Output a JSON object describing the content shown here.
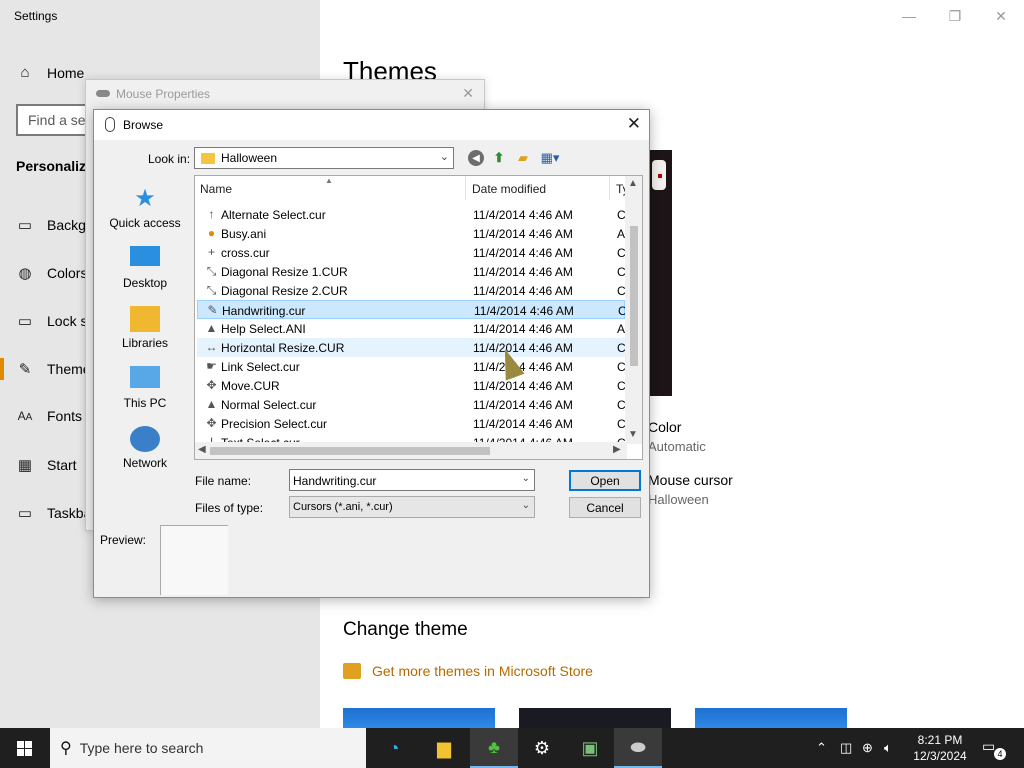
{
  "settings": {
    "title": "Settings",
    "home": "Home",
    "find_placeholder": "Find a set",
    "section": "Personaliza",
    "nav": [
      {
        "label": "Backgr"
      },
      {
        "label": "Colors"
      },
      {
        "label": "Lock s"
      },
      {
        "label": "Theme"
      },
      {
        "label": "Fonts"
      },
      {
        "label": "Start"
      },
      {
        "label": "Taskba"
      }
    ],
    "page_title": "Themes",
    "color_label": "Color",
    "color_value": "Automatic",
    "cursor_label": "Mouse cursor",
    "cursor_value": "Halloween",
    "change_theme": "Change theme",
    "store_link": "Get more themes in Microsoft Store",
    "accent_link_color": "#b36b00"
  },
  "mouse_properties": {
    "title": "Mouse Properties"
  },
  "browse": {
    "title": "Browse",
    "look_in_label": "Look in:",
    "look_in_value": "Halloween",
    "places": [
      "Quick access",
      "Desktop",
      "Libraries",
      "This PC",
      "Network"
    ],
    "columns": {
      "name": "Name",
      "date": "Date modified",
      "type": "Ty"
    },
    "files": [
      {
        "name": "Alternate Select.cur",
        "date": "11/4/2014 4:46 AM",
        "type": "Cu",
        "icon": "arrow-up-icon"
      },
      {
        "name": "Busy.ani",
        "date": "11/4/2014 4:46 AM",
        "type": "An",
        "icon": "pumpkin-icon"
      },
      {
        "name": "cross.cur",
        "date": "11/4/2014 4:46 AM",
        "type": "Cu",
        "icon": "crosshair-icon"
      },
      {
        "name": "Diagonal Resize 1.CUR",
        "date": "11/4/2014 4:46 AM",
        "type": "Cu",
        "icon": "diagonal-resize-icon"
      },
      {
        "name": "Diagonal Resize 2.CUR",
        "date": "11/4/2014 4:46 AM",
        "type": "Cu",
        "icon": "diagonal-resize-icon"
      },
      {
        "name": "Handwriting.cur",
        "date": "11/4/2014 4:46 AM",
        "type": "Cu",
        "icon": "pen-icon"
      },
      {
        "name": "Help Select.ANI",
        "date": "11/4/2014 4:46 AM",
        "type": "An",
        "icon": "witch-hat-icon"
      },
      {
        "name": "Horizontal Resize.CUR",
        "date": "11/4/2014 4:46 AM",
        "type": "Cu",
        "icon": "horizontal-resize-icon"
      },
      {
        "name": "Link Select.cur",
        "date": "11/4/2014 4:46 AM",
        "type": "Cu",
        "icon": "hand-icon"
      },
      {
        "name": "Move.CUR",
        "date": "11/4/2014 4:46 AM",
        "type": "Cu",
        "icon": "move-icon"
      },
      {
        "name": "Normal Select.cur",
        "date": "11/4/2014 4:46 AM",
        "type": "Cu",
        "icon": "witch-hat-icon"
      },
      {
        "name": "Precision Select.cur",
        "date": "11/4/2014 4:46 AM",
        "type": "Cu",
        "icon": "move-icon"
      },
      {
        "name": "Text Select.cur",
        "date": "11/4/2014 4:46 AM",
        "type": "Cu",
        "icon": "text-cursor-icon"
      }
    ],
    "selected_file": "Handwriting.cur",
    "file_name_label": "File name:",
    "file_name_value": "Handwriting.cur",
    "file_type_label": "Files of type:",
    "file_type_value": "Cursors (*.ani, *.cur)",
    "open_label": "Open",
    "cancel_label": "Cancel",
    "preview_label": "Preview:"
  },
  "taskbar": {
    "search_placeholder": "Type here to search",
    "time": "8:21 PM",
    "date": "12/3/2024",
    "notification_count": "4"
  }
}
